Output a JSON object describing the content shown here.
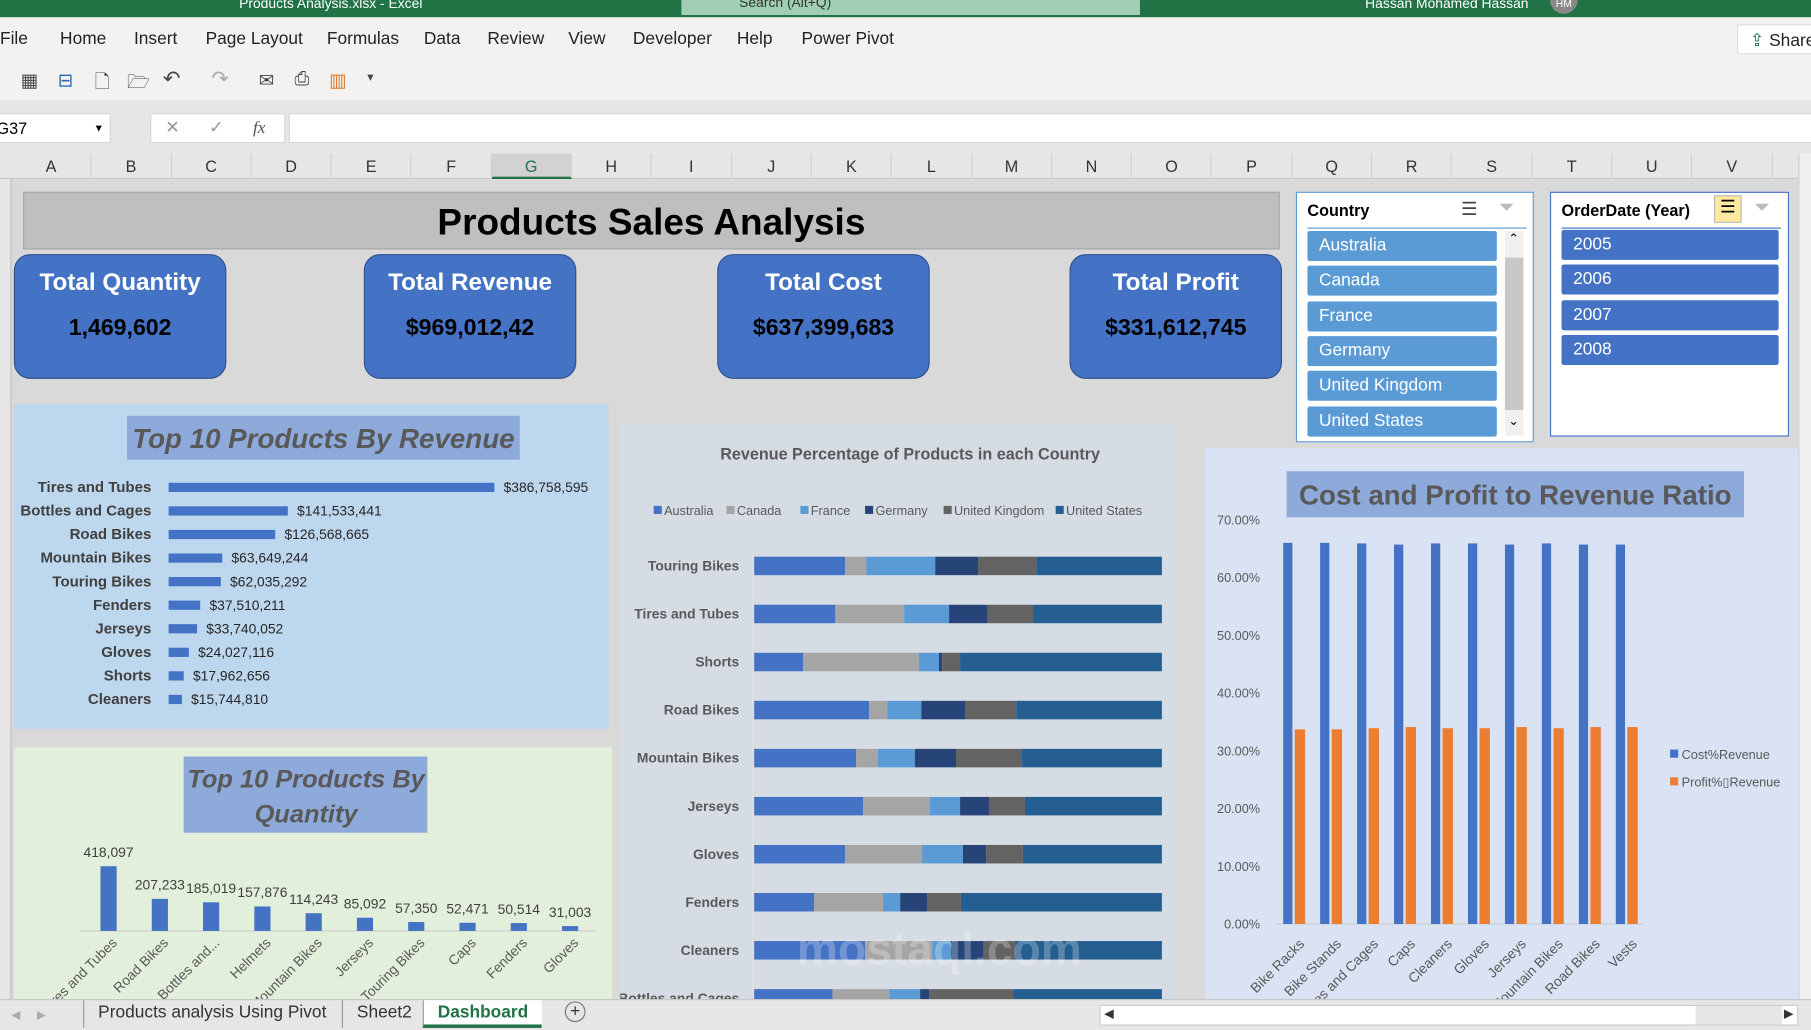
{
  "window": {
    "title": "Products Analysis.xlsx - Excel",
    "search": "Search (Alt+Q)",
    "user": "Hassan Mohamed Hassan",
    "avatar": "HM"
  },
  "ribbon": {
    "tabs": [
      "File",
      "Home",
      "Insert",
      "Page Layout",
      "Formulas",
      "Data",
      "Review",
      "View",
      "Developer",
      "Help",
      "Power Pivot"
    ],
    "share": "Share"
  },
  "formula_bar": {
    "name_box": "G37",
    "fx": "fx",
    "value": ""
  },
  "columns": [
    "A",
    "B",
    "C",
    "D",
    "E",
    "F",
    "G",
    "H",
    "I",
    "J",
    "K",
    "L",
    "M",
    "N",
    "O",
    "P",
    "Q",
    "R",
    "S",
    "T",
    "U",
    "V"
  ],
  "selected_column": "G",
  "dashboard": {
    "title": "Products Sales Analysis",
    "kpis": [
      {
        "label": "Total Quantity",
        "value": "1,469,602"
      },
      {
        "label": "Total Revenue",
        "value": "$969,012,42"
      },
      {
        "label": "Total Cost",
        "value": "$637,399,683"
      },
      {
        "label": "Total Profit",
        "value": "$331,612,745"
      }
    ],
    "slicers": {
      "country": {
        "title": "Country",
        "items": [
          "Australia",
          "Canada",
          "France",
          "Germany",
          "United Kingdom",
          "United States"
        ]
      },
      "year": {
        "title": "OrderDate (Year)",
        "items": [
          "2005",
          "2006",
          "2007",
          "2008"
        ]
      }
    }
  },
  "colors": {
    "excel_green": "#217346",
    "accent": "#4472c4",
    "orange": "#ed7d31"
  },
  "chart_data": [
    {
      "type": "bar",
      "orientation": "horizontal",
      "title": "Top 10 Products By Revenue",
      "categories": [
        "Tires and Tubes",
        "Bottles and Cages",
        "Road Bikes",
        "Mountain Bikes",
        "Touring Bikes",
        "Fenders",
        "Jerseys",
        "Gloves",
        "Shorts",
        "Cleaners"
      ],
      "values": [
        386758595,
        141533441,
        126568665,
        63649244,
        62035292,
        37510211,
        33740052,
        24027116,
        17962656,
        15744810
      ],
      "labels": [
        "$386,758,595",
        "$141,533,441",
        "$126,568,665",
        "$63,649,244",
        "$62,035,292",
        "$37,510,211",
        "$33,740,052",
        "$24,027,116",
        "$17,962,656",
        "$15,744,810"
      ]
    },
    {
      "type": "bar",
      "title": "Top 10 Products By Quantity",
      "categories": [
        "Tires and Tubes",
        "Road Bikes",
        "Bottles and...",
        "Helmets",
        "Mountain Bikes",
        "Jerseys",
        "Touring Bikes",
        "Caps",
        "Fenders",
        "Gloves"
      ],
      "values": [
        418097,
        207233,
        185019,
        157876,
        114243,
        85092,
        57350,
        52471,
        50514,
        31003
      ],
      "labels": [
        "418,097",
        "207,233",
        "185,019",
        "157,876",
        "114,243",
        "85,092",
        "57,350",
        "52,471",
        "50,514",
        "31,003"
      ]
    },
    {
      "type": "bar",
      "orientation": "horizontal",
      "stacked": "100%",
      "title": "Revenue Percentage of Products in each Country",
      "legend": "top",
      "categories": [
        "Touring Bikes",
        "Tires and Tubes",
        "Shorts",
        "Road Bikes",
        "Mountain Bikes",
        "Jerseys",
        "Gloves",
        "Fenders",
        "Cleaners",
        "Bottles and Cages"
      ],
      "series": [
        {
          "name": "Australia",
          "color": "#4472c4",
          "values": [
            22.3,
            19.9,
            12.0,
            28.2,
            25.0,
            26.7,
            22.3,
            14.7,
            27.2,
            19.2
          ]
        },
        {
          "name": "Canada",
          "color": "#a5a5a5",
          "values": [
            5.2,
            16.9,
            28.4,
            4.5,
            5.3,
            16.4,
            18.8,
            16.9,
            16.5,
            13.9
          ]
        },
        {
          "name": "France",
          "color": "#5b9bd5",
          "values": [
            16.9,
            11.0,
            4.9,
            8.3,
            9.1,
            7.4,
            10.1,
            4.2,
            4.6,
            7.6
          ]
        },
        {
          "name": "Germany",
          "color": "#264478",
          "values": [
            10.5,
            9.4,
            0.8,
            10.8,
            10.1,
            7.1,
            5.7,
            6.6,
            8.0,
            2.2
          ]
        },
        {
          "name": "United Kingdom",
          "color": "#636363",
          "values": [
            14.3,
            11.2,
            4.4,
            12.5,
            16.2,
            8.8,
            9.0,
            8.3,
            7.8,
            20.6
          ]
        },
        {
          "name": "United States",
          "color": "#255e91",
          "values": [
            30.8,
            31.6,
            49.5,
            35.7,
            34.3,
            33.6,
            34.1,
            49.3,
            35.9,
            36.5
          ]
        }
      ]
    },
    {
      "type": "bar",
      "title": "Cost and Profit to Revenue Ratio",
      "legend": "right",
      "ylim": [
        0,
        70
      ],
      "yticks": [
        "0.00%",
        "10.00%",
        "20.00%",
        "30.00%",
        "40.00%",
        "50.00%",
        "60.00%",
        "70.00%"
      ],
      "categories": [
        "Bike Racks",
        "Bike Stands",
        "Bottles and Cages",
        "Caps",
        "Cleaners",
        "Gloves",
        "Jerseys",
        "Mountain Bikes",
        "Road Bikes",
        "Vests"
      ],
      "series": [
        {
          "name": "Cost%Revenue",
          "color": "#4472c4",
          "values": [
            66.0,
            66.0,
            65.9,
            65.7,
            65.9,
            65.9,
            65.7,
            65.9,
            65.7,
            65.7
          ]
        },
        {
          "name": "Profit%▯Revenue",
          "color": "#ed7d31",
          "values": [
            33.7,
            33.7,
            33.9,
            34.1,
            33.9,
            33.9,
            34.1,
            33.9,
            34.1,
            34.1
          ]
        }
      ]
    }
  ],
  "watermark": "mostaql.com",
  "sheet_tabs": [
    "Products analysis Using Pivot",
    "Sheet2",
    "Dashboard"
  ],
  "active_tab": "Dashboard"
}
